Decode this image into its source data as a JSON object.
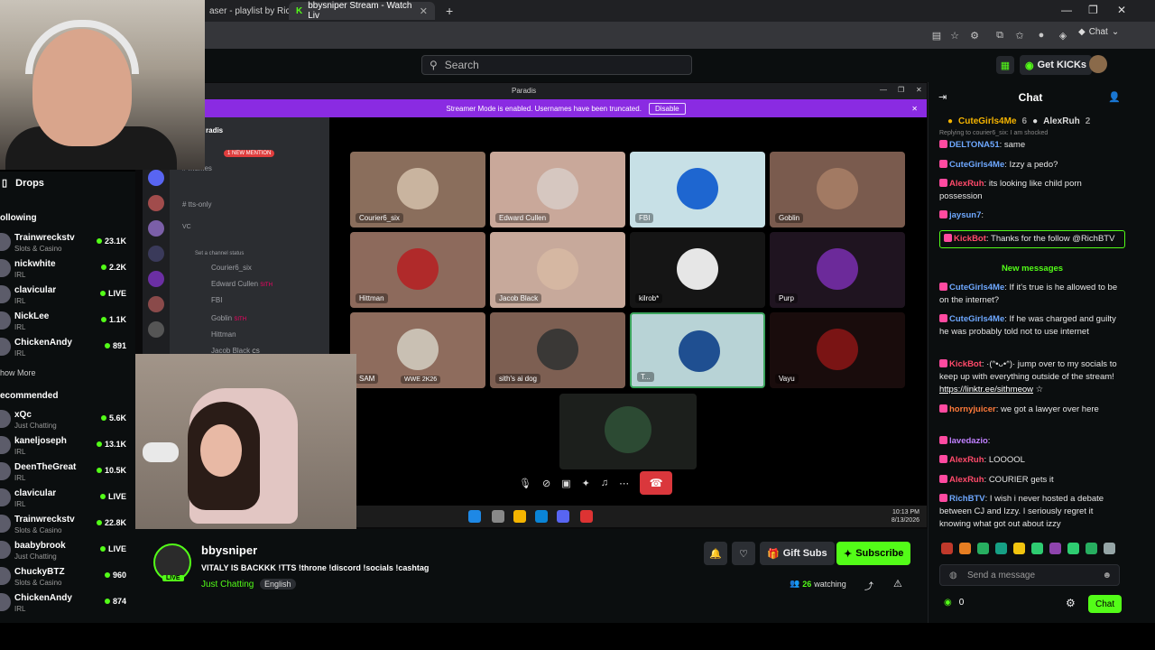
{
  "browser": {
    "tabs": [
      {
        "label": "aser - playlist by Rich",
        "active": false
      },
      {
        "label": "bbysniper Stream - Watch Liv",
        "active": true
      }
    ],
    "new_tab": "+",
    "chat_button": "Chat"
  },
  "kick_header": {
    "search_placeholder": "Search",
    "get_kicks": "Get KICKs"
  },
  "sidebar": {
    "drops_label": "Drops",
    "following_label": "ollowing",
    "show_more": "how More",
    "recommended_label": "ecommended",
    "following": [
      {
        "name": "Trainwreckstv",
        "category": "Slots & Casino",
        "viewers": "23.1K"
      },
      {
        "name": "nickwhite",
        "category": "IRL",
        "viewers": "2.2K"
      },
      {
        "name": "clavicular",
        "category": "IRL",
        "viewers": "LIVE"
      },
      {
        "name": "NickLee",
        "category": "IRL",
        "viewers": "1.1K"
      },
      {
        "name": "ChickenAndy",
        "category": "IRL",
        "viewers": "891"
      }
    ],
    "recommended": [
      {
        "name": "xQc",
        "category": "Just Chatting",
        "viewers": "5.6K"
      },
      {
        "name": "kaneljoseph",
        "category": "IRL",
        "viewers": "13.1K"
      },
      {
        "name": "DeenTheGreat",
        "category": "IRL",
        "viewers": "10.5K"
      },
      {
        "name": "clavicular",
        "category": "IRL",
        "viewers": "LIVE"
      },
      {
        "name": "Trainwreckstv",
        "category": "Slots & Casino",
        "viewers": "22.8K"
      },
      {
        "name": "baabybrook",
        "category": "Just Chatting",
        "viewers": "LIVE"
      },
      {
        "name": "ChuckyBTZ",
        "category": "Slots & Casino",
        "viewers": "960"
      },
      {
        "name": "ChickenAndy",
        "category": "IRL",
        "viewers": "874"
      }
    ]
  },
  "discord": {
    "window_title": "Paradis",
    "streamer_mode_text": "Streamer Mode is enabled. Usernames have been truncated.",
    "disable_label": "Disable",
    "server_name": "radis",
    "mention_badge": "1 NEW MENTION",
    "channels": [
      "memes",
      "tts-only"
    ],
    "vc_label": "VC",
    "status_hint": "Set a channel status",
    "voice_members": [
      "Courier6_six",
      "Edward Cullen",
      "FBI",
      "Goblin",
      "Hittman",
      "Jacob Black"
    ],
    "sith_tag": "SITH",
    "cs_tag": "CS",
    "tiles": [
      {
        "label": "Courier6_six",
        "bg": "#8a6e5c",
        "face": "#c9b49f"
      },
      {
        "label": "Edward Cullen",
        "bg": "#c9a89a",
        "face": "#d6c7c0"
      },
      {
        "label": "FBI",
        "bg": "#c7e0e6",
        "face": "#1e66d0"
      },
      {
        "label": "Goblin",
        "bg": "#7a5b4e",
        "face": "#a27a63"
      },
      {
        "label": "Hittman",
        "bg": "#8d6a5c",
        "face": "#b02a2a"
      },
      {
        "label": "Jacob Black",
        "bg": "#c7a99b",
        "face": "#d5b7a2"
      },
      {
        "label": "kilrob*",
        "bg": "#151515",
        "face": "#e6e6e6"
      },
      {
        "label": "Purp",
        "bg": "#1f1420",
        "face": "#6c2a9a"
      },
      {
        "label": "SAM",
        "bg": "#8e6c5d",
        "face": "#c9c0b3"
      },
      {
        "label": "sith's ai dog",
        "bg": "#7d5f52",
        "face": "#3a3836"
      },
      {
        "label": "T...",
        "bg": "#b8d3d6",
        "face": "#1f4f91"
      },
      {
        "label": "Vayu",
        "bg": "#190c0c",
        "face": "#7a1414"
      }
    ],
    "sam_tag": "WWE 2K26",
    "taskbar_time": "10:13 PM",
    "taskbar_date": "8/13/2026"
  },
  "stream_info": {
    "streamer": "bbysniper",
    "live_badge": "LIVE",
    "title": "VITALY IS BACKKK !TTS !throne !discord !socials !cashtag",
    "category": "Just Chatting",
    "language": "English",
    "gift_subs": "Gift Subs",
    "subscribe": "Subscribe",
    "watching_count": "26",
    "watching_label": "watching"
  },
  "chat": {
    "title": "Chat",
    "pinned": [
      {
        "name": "CuteGirls4Me",
        "count": "6"
      },
      {
        "name": "AlexRuh",
        "count": "2"
      }
    ],
    "reply_hint": "Replying to courier6_six: I am shocked",
    "messages": [
      {
        "user": "DELTONA51",
        "color": "#6ea8ff",
        "text": ": same"
      },
      {
        "user": "CuteGirls4Me",
        "color": "#6ea8ff",
        "text": ": Izzy a pedo?"
      },
      {
        "user": "AlexRuh",
        "color": "#ff4a6a",
        "text": ": its looking like child porn possession"
      },
      {
        "user": "jaysun7",
        "color": "#6ea8ff",
        "text": ":"
      },
      {
        "user": "KickBot",
        "color": "#ff4a6a",
        "text": ": Thanks for the follow @RichBTV"
      }
    ],
    "new_messages": "New messages",
    "messages2": [
      {
        "user": "CuteGirls4Me",
        "color": "#6ea8ff",
        "text": ": If it's true is he allowed to be on the internet?"
      },
      {
        "user": "CuteGirls4Me",
        "color": "#6ea8ff",
        "text": ": If he was charged and guilty he was probably told not to use internet"
      },
      {
        "user": "KickBot",
        "color": "#ff4a6a",
        "text": ": ·(ᐢ•ᴗ•ᐢ)· jump over to my socials to keep up with everything outside of the stream!",
        "link": "https://linktr.ee/sithmeow",
        "after": " ☆"
      },
      {
        "user": "hornyjuicer",
        "color": "#ff7a3a",
        "text": ": we got a lawyer over here"
      },
      {
        "user": "lavedazio",
        "color": "#c080ff",
        "text": ":"
      },
      {
        "user": "AlexRuh",
        "color": "#ff4a6a",
        "text": ": LOOOOL"
      },
      {
        "user": "AlexRuh",
        "color": "#ff4a6a",
        "text": ": COURIER gets it"
      },
      {
        "user": "RichBTV",
        "color": "#6ea8ff",
        "text": ": I wish i never hosted a debate between CJ and Izzy. I seriously regret it knowing what got out about izzy"
      }
    ],
    "input_placeholder": "Send a message",
    "kicks_balance": "0",
    "send_label": "Chat"
  }
}
